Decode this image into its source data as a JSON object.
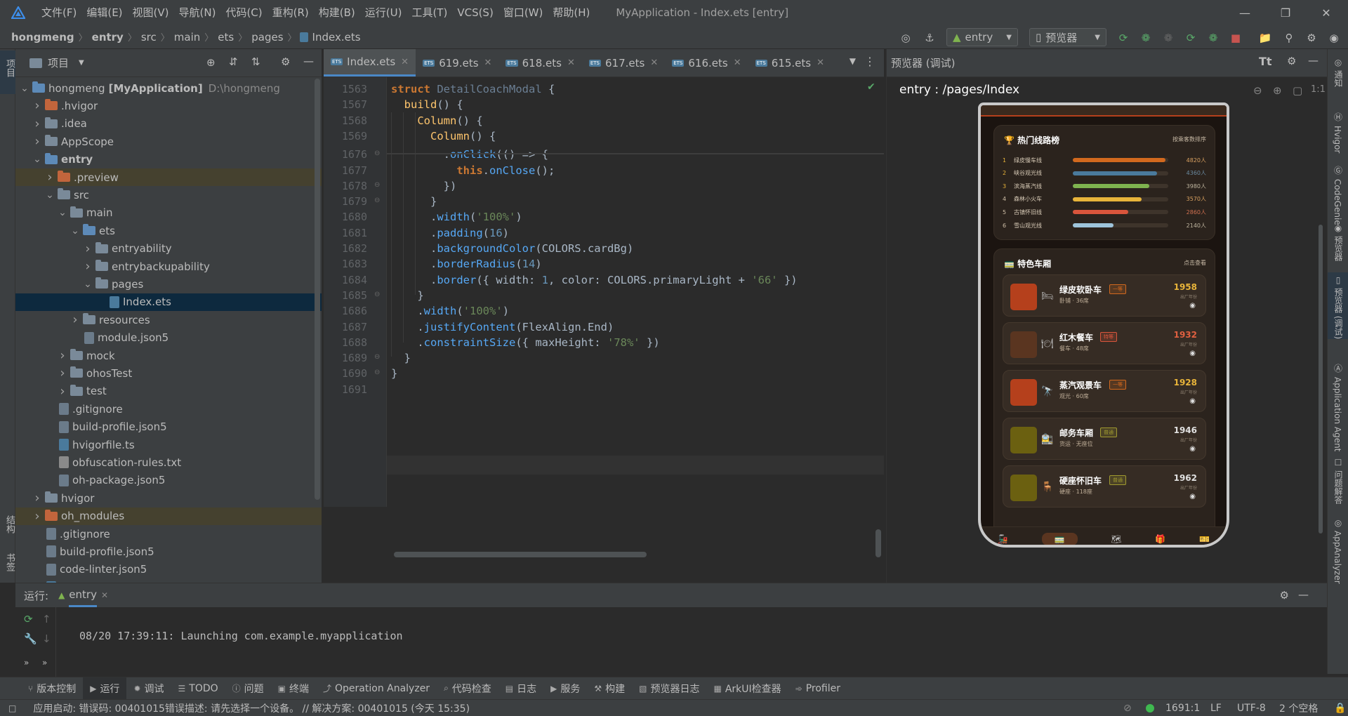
{
  "window": {
    "title": "MyApplication - Index.ets [entry]",
    "menus": [
      "文件(F)",
      "编辑(E)",
      "视图(V)",
      "导航(N)",
      "代码(C)",
      "重构(R)",
      "构建(B)",
      "运行(U)",
      "工具(T)",
      "VCS(S)",
      "窗口(W)",
      "帮助(H)"
    ]
  },
  "breadcrumb": [
    "hongmeng",
    "entry",
    "src",
    "main",
    "ets",
    "pages",
    "Index.ets"
  ],
  "toolbar": {
    "config": "entry",
    "previewer": "预览器"
  },
  "left_strip": {
    "project_label": "项目",
    "structure_label": "结构",
    "bookmarks_label": "书签"
  },
  "project": {
    "title": "项目",
    "tree": [
      {
        "label": "hongmeng",
        "extra": "[MyApplication]",
        "path": "D:\\hongmeng",
        "depth": 0,
        "type": "folder-blue",
        "arrow": "open"
      },
      {
        "label": ".hvigor",
        "depth": 1,
        "type": "folder-orange",
        "arrow": "closed"
      },
      {
        "label": ".idea",
        "depth": 1,
        "type": "folder",
        "arrow": "closed"
      },
      {
        "label": "AppScope",
        "depth": 1,
        "type": "folder",
        "arrow": "closed"
      },
      {
        "label": "entry",
        "depth": 1,
        "type": "folder-blue",
        "arrow": "open",
        "bold": true
      },
      {
        "label": ".preview",
        "depth": 2,
        "type": "folder-orange",
        "arrow": "closed",
        "highlight": true
      },
      {
        "label": "src",
        "depth": 2,
        "type": "folder",
        "arrow": "open"
      },
      {
        "label": "main",
        "depth": 3,
        "type": "folder",
        "arrow": "open"
      },
      {
        "label": "ets",
        "depth": 4,
        "type": "folder-blue",
        "arrow": "open"
      },
      {
        "label": "entryability",
        "depth": 5,
        "type": "folder",
        "arrow": "closed"
      },
      {
        "label": "entrybackupability",
        "depth": 5,
        "type": "folder",
        "arrow": "closed"
      },
      {
        "label": "pages",
        "depth": 5,
        "type": "folder",
        "arrow": "open"
      },
      {
        "label": "Index.ets",
        "depth": 6,
        "type": "file-ts",
        "selected": true
      },
      {
        "label": "resources",
        "depth": 4,
        "type": "folder",
        "arrow": "closed"
      },
      {
        "label": "module.json5",
        "depth": 4,
        "type": "file"
      },
      {
        "label": "mock",
        "depth": 3,
        "type": "folder",
        "arrow": "closed"
      },
      {
        "label": "ohosTest",
        "depth": 3,
        "type": "folder",
        "arrow": "closed"
      },
      {
        "label": "test",
        "depth": 3,
        "type": "folder",
        "arrow": "closed"
      },
      {
        "label": ".gitignore",
        "depth": 2,
        "type": "file"
      },
      {
        "label": "build-profile.json5",
        "depth": 2,
        "type": "file"
      },
      {
        "label": "hvigorfile.ts",
        "depth": 2,
        "type": "file-ts"
      },
      {
        "label": "obfuscation-rules.txt",
        "depth": 2,
        "type": "file-txt"
      },
      {
        "label": "oh-package.json5",
        "depth": 2,
        "type": "file"
      },
      {
        "label": "hvigor",
        "depth": 1,
        "type": "folder",
        "arrow": "closed"
      },
      {
        "label": "oh_modules",
        "depth": 1,
        "type": "folder-orange",
        "arrow": "closed",
        "highlight": true
      },
      {
        "label": ".gitignore",
        "depth": 1,
        "type": "file"
      },
      {
        "label": "build-profile.json5",
        "depth": 1,
        "type": "file"
      },
      {
        "label": "code-linter.json5",
        "depth": 1,
        "type": "file"
      },
      {
        "label": "hvigorfile.ts",
        "depth": 1,
        "type": "file-ts"
      }
    ]
  },
  "editor": {
    "tabs": [
      {
        "label": "Index.ets",
        "active": true
      },
      {
        "label": "619.ets"
      },
      {
        "label": "618.ets"
      },
      {
        "label": "617.ets"
      },
      {
        "label": "616.ets"
      },
      {
        "label": "615.ets"
      }
    ],
    "lines": [
      {
        "n": "1563",
        "html": "<span class='k'>struct</span> <span class='dim'>DetailCoachModal</span> {"
      },
      {
        "n": "1567",
        "html": "  <span class='f'>build</span>() {"
      },
      {
        "n": "1568",
        "html": "    <span class='f'>Column</span>() {"
      },
      {
        "n": "1569",
        "html": "      <span class='f'>Column</span>() {"
      },
      {
        "n": "1676",
        "html": "        .<span class='m'>onClick</span>(() => {"
      },
      {
        "n": "1677",
        "html": "          <span class='k'>this</span>.<span class='m'>onClose</span>();"
      },
      {
        "n": "1678",
        "html": "        })"
      },
      {
        "n": "1679",
        "html": "      }"
      },
      {
        "n": "1680",
        "html": "      .<span class='m'>width</span>(<span class='s'>'100%'</span>)"
      },
      {
        "n": "1681",
        "html": "      .<span class='m'>padding</span>(<span class='n'>16</span>)"
      },
      {
        "n": "1682",
        "html": "      .<span class='m'>backgroundColor</span>(COLORS.cardBg)"
      },
      {
        "n": "1683",
        "html": "      .<span class='m'>borderRadius</span>(<span class='n'>14</span>)"
      },
      {
        "n": "1684",
        "html": "      .<span class='m'>border</span>({ width: <span class='n'>1</span>, color: COLORS.primaryLight + <span class='s'>'66'</span> })"
      },
      {
        "n": "1685",
        "html": "    }"
      },
      {
        "n": "1686",
        "html": "    .<span class='m'>width</span>(<span class='s'>'100%'</span>)"
      },
      {
        "n": "1687",
        "html": "    .<span class='m'>justifyContent</span>(FlexAlign.End)"
      },
      {
        "n": "1688",
        "html": "    .<span class='m'>constraintSize</span>({ maxHeight: <span class='s'>'78%'</span> })"
      },
      {
        "n": "1689",
        "html": "  }"
      },
      {
        "n": "1690",
        "html": "}"
      },
      {
        "n": "1691",
        "html": ""
      }
    ]
  },
  "preview": {
    "title": "预览器 (调试)",
    "route": "entry : /pages/Index",
    "app": {
      "ranking": {
        "title": "🏆 热门线路榜",
        "more": "按乘客数排序",
        "rows": [
          {
            "no": "1",
            "name": "绿皮慢车线",
            "value": "4820人",
            "fill": 0.97,
            "color": "#d2691e",
            "vcolor": "#d8a060"
          },
          {
            "no": "2",
            "name": "峡谷观光线",
            "value": "4360人",
            "fill": 0.88,
            "color": "#4a7a9c",
            "vcolor": "#6a8aa0"
          },
          {
            "no": "3",
            "name": "滨海蒸汽线",
            "value": "3980人",
            "fill": 0.8,
            "color": "#7fb34f",
            "vcolor": "#c0b6a0"
          },
          {
            "no": "4",
            "name": "森林小火车",
            "value": "3570人",
            "fill": 0.72,
            "color": "#e8b43a",
            "vcolor": "#d8a060"
          },
          {
            "no": "5",
            "name": "古镇怀旧线",
            "value": "2860人",
            "fill": 0.58,
            "color": "#d9553c",
            "vcolor": "#d07050"
          },
          {
            "no": "6",
            "name": "雪山观光线",
            "value": "2140人",
            "fill": 0.43,
            "color": "#9ec4db",
            "vcolor": "#c0b6a0"
          }
        ]
      },
      "cars": {
        "title": "🚃 特色车厢",
        "more": "点击查看",
        "items": [
          {
            "name": "绿皮软卧车",
            "tag": "一等",
            "desc": "卧铺 · 36席",
            "year": "1958",
            "ylabel": "出厂年份",
            "thumb": "#b5401c",
            "icon": "🛏",
            "tagc": "#d2691e",
            "yc": "#e8b43a"
          },
          {
            "name": "红木餐车",
            "tag": "特等",
            "desc": "餐车 · 48席",
            "year": "1932",
            "ylabel": "出厂年份",
            "thumb": "#5a3520",
            "icon": "🍽",
            "tagc": "#d9553c",
            "yc": "#e06040"
          },
          {
            "name": "蒸汽观景车",
            "tag": "一等",
            "desc": "观光 · 60席",
            "year": "1928",
            "ylabel": "出厂年份",
            "thumb": "#b5401c",
            "icon": "🔭",
            "tagc": "#d2691e",
            "yc": "#e8b43a"
          },
          {
            "name": "邮务车厢",
            "tag": "普通",
            "desc": "货运 · 无座位",
            "year": "1946",
            "ylabel": "出厂年份",
            "thumb": "#6b6010",
            "icon": "🚉",
            "tagc": "#a09a30",
            "yc": "#e0e0e0"
          },
          {
            "name": "硬座怀旧车",
            "tag": "普通",
            "desc": "硬座 · 118座",
            "year": "1962",
            "ylabel": "出厂年份",
            "thumb": "#6b6010",
            "icon": "🪑",
            "tagc": "#a09a30",
            "yc": "#e0e0e0"
          }
        ]
      }
    }
  },
  "right_strip": [
    "通知",
    "Hvigor",
    "CodeGenie",
    "预览器",
    "预览器 (调试)",
    "Application Agent",
    "问题解答",
    "AppAnalyzer"
  ],
  "run": {
    "label": "运行:",
    "tab": "entry",
    "log": "08/20 17:39:11: Launching com.example.myapplication"
  },
  "bottom_tabs": [
    "版本控制",
    "运行",
    "调试",
    "TODO",
    "问题",
    "终端",
    "Operation Analyzer",
    "代码检查",
    "日志",
    "服务",
    "构建",
    "预览器日志",
    "ArkUI检查器",
    "Profiler"
  ],
  "status": {
    "message": "应用启动: 错误码: 00401015错误描述: 请先选择一个设备。 // 解决方案: 00401015 (今天 15:35)",
    "position": "1691:1",
    "line_sep": "LF",
    "encoding": "UTF-8",
    "indent": "2 个空格"
  }
}
